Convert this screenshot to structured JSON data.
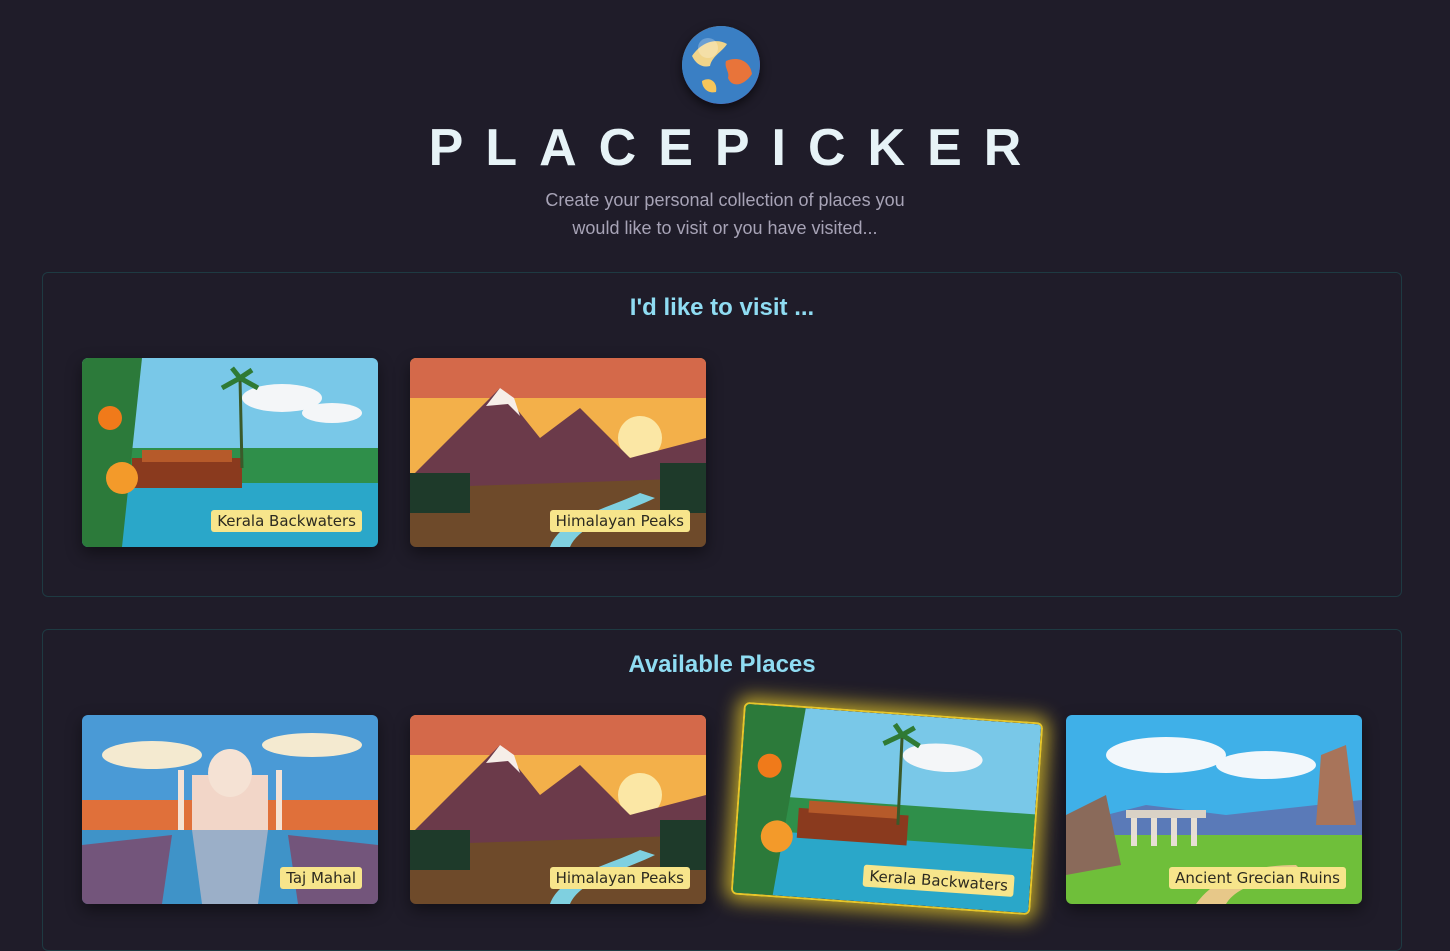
{
  "header": {
    "title": "PLACEPICKER",
    "subtitle_line1": "Create your personal collection of places you",
    "subtitle_line2": "would like to visit or you have visited...",
    "logo_icon": "globe-icon"
  },
  "visit_section": {
    "heading": "I'd like to visit ...",
    "places": [
      {
        "label": "Kerala Backwaters",
        "image": "kerala-backwaters-image"
      },
      {
        "label": "Himalayan Peaks",
        "image": "himalayan-peaks-image"
      }
    ]
  },
  "available_section": {
    "heading": "Available Places",
    "places": [
      {
        "label": "Taj Mahal",
        "image": "taj-mahal-image"
      },
      {
        "label": "Himalayan Peaks",
        "image": "himalayan-peaks-image"
      },
      {
        "label": "Kerala Backwaters",
        "image": "kerala-backwaters-image",
        "state": "hover-highlighted"
      },
      {
        "label": "Ancient Grecian Ruins",
        "image": "ancient-grecian-ruins-image"
      }
    ]
  },
  "colors": {
    "background": "#1f1c29",
    "title": "#e7f3f7",
    "section_heading": "#8fdcf2",
    "label_bg": "#f7e58b",
    "highlight": "#e6c62a"
  }
}
